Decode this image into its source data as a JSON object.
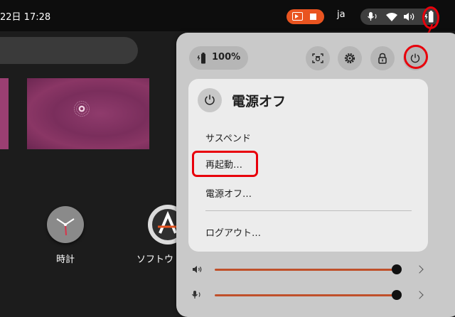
{
  "topbar": {
    "datetime": "22日 17:28",
    "language": "ja"
  },
  "apps": {
    "clock_label": "時計",
    "software_label": "ソフトウ"
  },
  "quick_settings": {
    "battery_percent": "100%",
    "power_menu": {
      "title": "電源オフ",
      "items": [
        "サスペンド",
        "再起動…",
        "電源オフ…",
        "ログアウト…"
      ]
    },
    "sliders": [
      {
        "name": "volume",
        "level": 1.0
      },
      {
        "name": "microphone",
        "level": 1.0
      }
    ]
  },
  "colors": {
    "accent": "#e95420",
    "annotation": "#e8000b"
  }
}
